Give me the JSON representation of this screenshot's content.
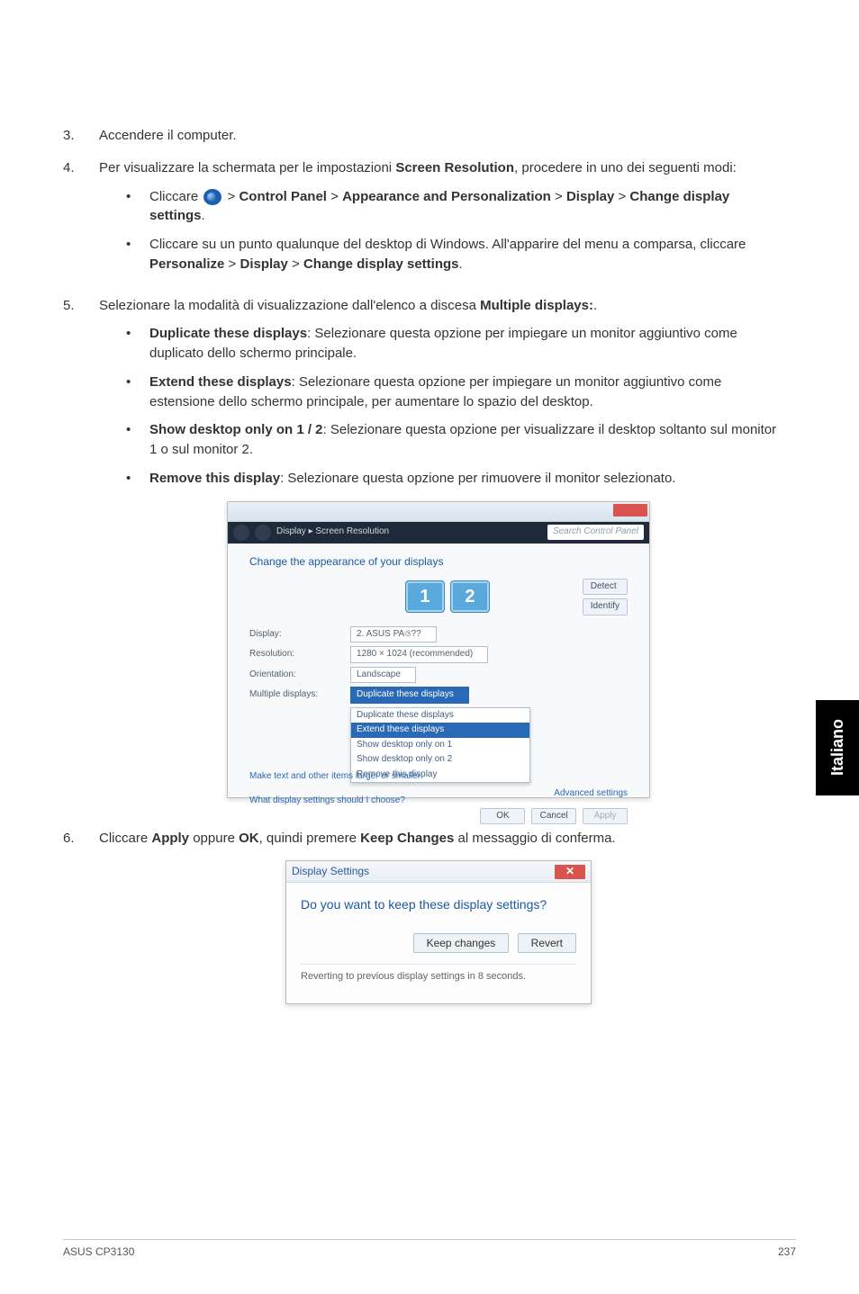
{
  "steps": {
    "s3": {
      "num": "3.",
      "text": "Accendere il computer."
    },
    "s4": {
      "num": "4.",
      "intro_a": "Per visualizzare la schermata per le impostazioni ",
      "intro_bold": "Screen Resolution",
      "intro_b": ", procedere in uno dei seguenti modi:",
      "sub1_a": "Cliccare ",
      "sub1_b": " > ",
      "sub1_c": "Control Panel",
      "sub1_d": " > ",
      "sub1_e": "Appearance and Personalization",
      "sub1_f": " > ",
      "sub1_g": "Display",
      "sub1_h": " > ",
      "sub1_i": "Change display settings",
      "sub1_j": ".",
      "sub2_a": "Cliccare su un punto qualunque del desktop di Windows. All'apparire del menu a comparsa, cliccare  ",
      "sub2_b": "Personalize",
      "sub2_c": " > ",
      "sub2_d": "Display",
      "sub2_e": " > ",
      "sub2_f": "Change display settings",
      "sub2_g": "."
    },
    "s5": {
      "num": "5.",
      "intro_a": "Selezionare la modalità di visualizzazione dall'elenco a discesa ",
      "intro_bold": "Multiple displays:",
      "intro_b": ".",
      "opt1_t": "Duplicate these displays",
      "opt1_d": ": Selezionare questa opzione per impiegare un monitor aggiuntivo come duplicato dello schermo principale.",
      "opt2_t": "Extend these displays",
      "opt2_d": ": Selezionare questa opzione per impiegare un monitor aggiuntivo come estensione dello schermo principale, per aumentare lo spazio del desktop.",
      "opt3_t": "Show desktop only on 1 / 2",
      "opt3_d": ": Selezionare questa opzione per visualizzare il desktop soltanto sul monitor 1 o sul monitor 2.",
      "opt4_t": "Remove this display",
      "opt4_d": ": Selezionare questa opzione per rimuovere il monitor selezionato."
    },
    "s6": {
      "num": "6.",
      "a": "Cliccare ",
      "b": "Apply",
      "c": " oppure ",
      "d": "OK",
      "e": ", quindi premere ",
      "f": "Keep Changes",
      "g": " al messaggio di conferma."
    }
  },
  "shot1": {
    "breadcrumb": "Display  ▸  Screen Resolution",
    "search_placeholder": "Search Control Panel",
    "heading": "Change the appearance of your displays",
    "mon1": "1",
    "mon2": "2",
    "btn_detect": "Detect",
    "btn_identify": "Identify",
    "lbl_display": "Display:",
    "val_display": "2. ASUS PAও??",
    "lbl_resolution": "Resolution:",
    "val_resolution": "1280 × 1024 (recommended)",
    "lbl_orientation": "Orientation:",
    "val_orientation": "Landscape",
    "lbl_multiple": "Multiple displays:",
    "val_multiple": "Duplicate these displays",
    "dd_opt1": "Duplicate these displays",
    "dd_opt2": "Extend these displays",
    "dd_opt3": "Show desktop only on 1",
    "dd_opt4": "Show desktop only on 2",
    "dd_opt5": "Remove this display",
    "link_main": "Make text and other items larger or smaller",
    "link_adv": "Advanced settings",
    "link_what": "What display settings should I choose?",
    "btn_ok": "OK",
    "btn_cancel": "Cancel",
    "btn_apply": "Apply"
  },
  "shot2": {
    "title": "Display Settings",
    "close": "✕",
    "question": "Do you want to keep these display settings?",
    "btn_keep": "Keep changes",
    "btn_revert": "Revert",
    "footer": "Reverting to previous display settings in 8 seconds."
  },
  "sidetab": "Italiano",
  "footer_left": "ASUS CP3130",
  "footer_right": "237"
}
